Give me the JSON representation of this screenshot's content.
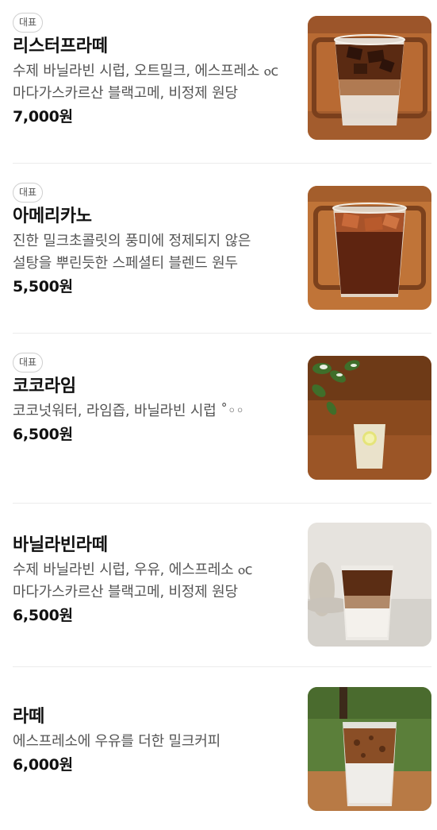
{
  "badge_label": "대표",
  "menu": [
    {
      "name": "리스터프라떼",
      "description": "수제 바닐라빈 시럽, 오트밀크, 에스프레소 ⲟᴄ 마다가스카르산 블랙고메, 비정제 원당",
      "price": "7,000원",
      "signature": true,
      "image_icon": "iced-latte-photo"
    },
    {
      "name": "아메리카노",
      "description": "진한 밀크초콜릿의 풍미에 정제되지 않은 설탕을 뿌린듯한 스페셜티 블렌드 원두",
      "price": "5,500원",
      "signature": true,
      "image_icon": "iced-americano-photo"
    },
    {
      "name": "코코라임",
      "description": "코코넛워터, 라임즙, 바닐라빈 시럽 ˚◦◦",
      "price": "6,500원",
      "signature": true,
      "image_icon": "coco-lime-photo"
    },
    {
      "name": "바닐라빈라떼",
      "description": "수제 바닐라빈 시럽, 우유, 에스프레소 ⲟᴄ 마다가스카르산 블랙고메, 비정제 원당",
      "price": "6,500원",
      "signature": false,
      "image_icon": "vanilla-latte-photo"
    },
    {
      "name": "라떼",
      "description": "에스프레소에 우유를 더한 밀크커피",
      "price": "6,000원",
      "signature": false,
      "image_icon": "latte-photo"
    }
  ]
}
